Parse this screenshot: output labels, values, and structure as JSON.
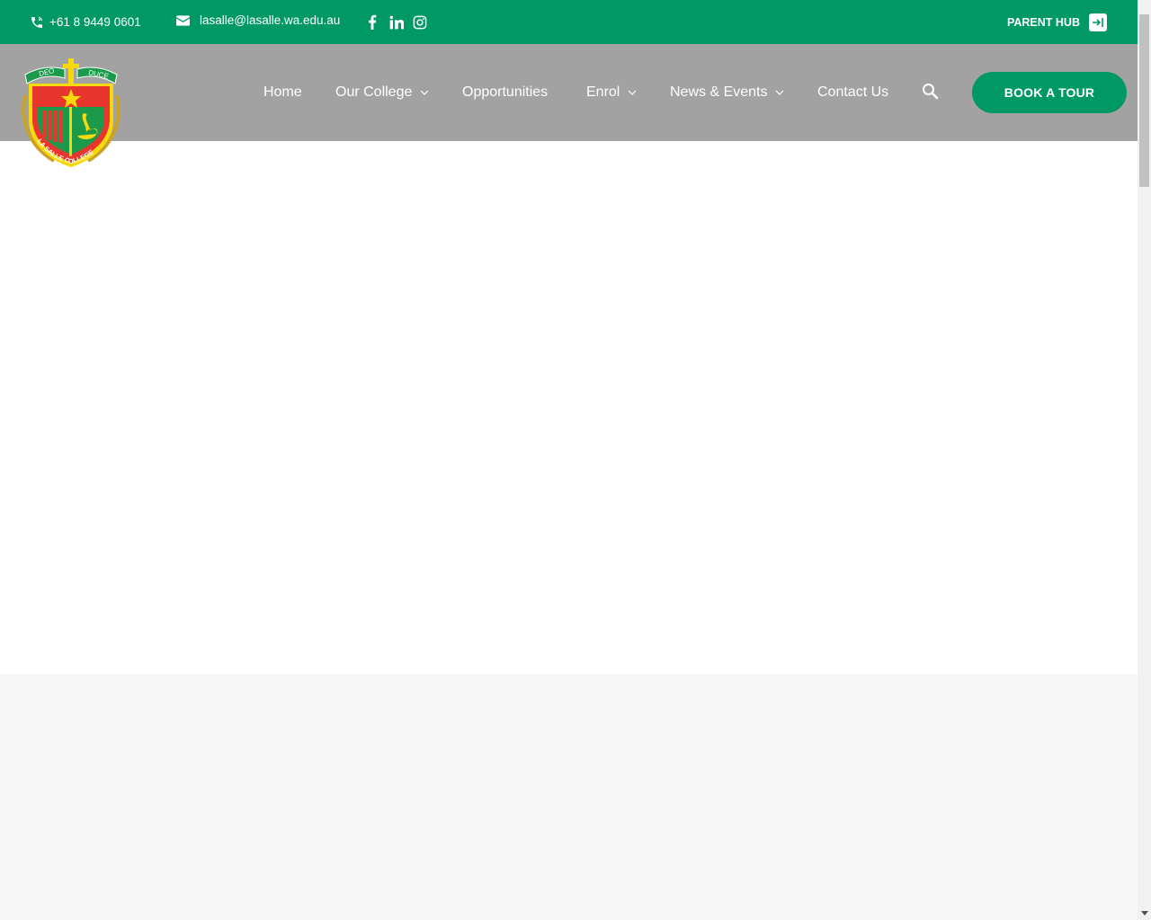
{
  "topbar": {
    "phone": "+61 8 9449 0601",
    "email": "lasalle@lasalle.wa.edu.au",
    "social": [
      "facebook-icon",
      "linkedin-icon",
      "instagram-icon"
    ],
    "parent_hub": "PARENT HUB"
  },
  "logo": {
    "motto_left": "DEO",
    "motto_right": "DUCE",
    "name_text": "LA SALLE COLLEGE"
  },
  "nav": {
    "home": "Home",
    "our_college": "Our College",
    "opportunities": "Opportunities",
    "enrol": "Enrol",
    "news_events": "News & Events",
    "contact_us": "Contact Us"
  },
  "cta": {
    "book_tour": "BOOK A TOUR"
  },
  "colors": {
    "brand_green": "#009966",
    "header_grey": "#a2a2a2",
    "crest_red": "#e8352e",
    "crest_yellow": "#f5d90a"
  }
}
